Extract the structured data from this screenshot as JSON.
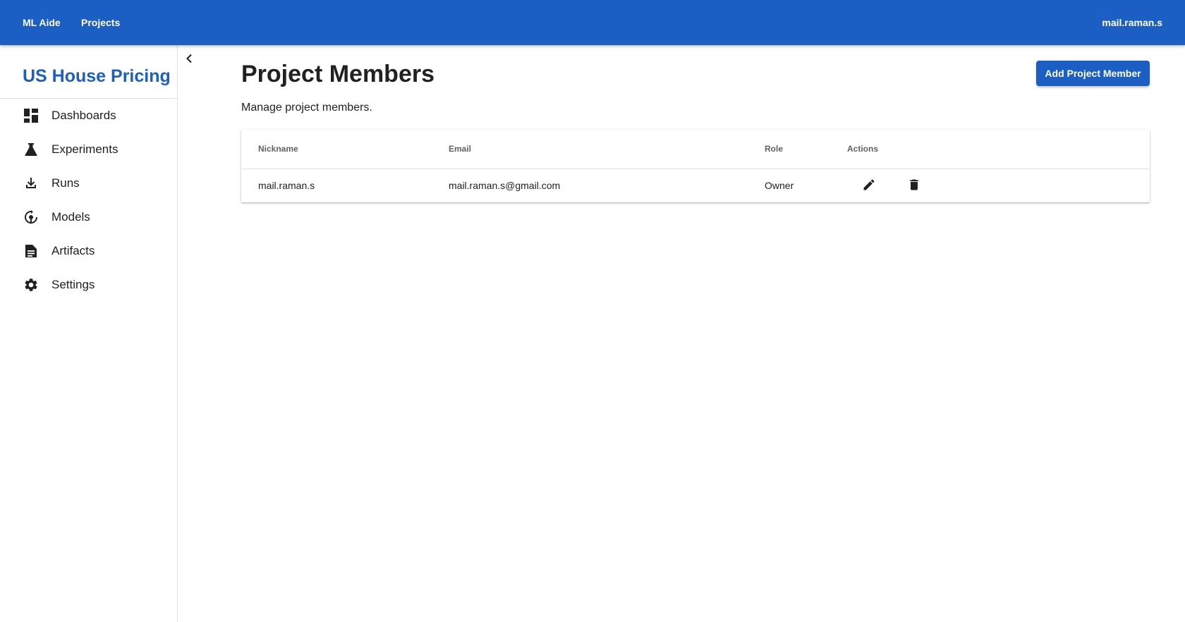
{
  "topbar": {
    "brand": "ML Aide",
    "projects": "Projects",
    "user": "mail.raman.s"
  },
  "sidebar": {
    "project_title": "US House Pricing",
    "items": [
      {
        "label": "Dashboards",
        "icon": "dashboard-icon"
      },
      {
        "label": "Experiments",
        "icon": "flask-icon"
      },
      {
        "label": "Runs",
        "icon": "run-download-icon"
      },
      {
        "label": "Models",
        "icon": "model-cycle-icon"
      },
      {
        "label": "Artifacts",
        "icon": "document-icon"
      },
      {
        "label": "Settings",
        "icon": "gear-icon"
      }
    ]
  },
  "main": {
    "title": "Project Members",
    "subtitle": "Manage project members.",
    "add_button": "Add Project Member",
    "table": {
      "headers": {
        "nickname": "Nickname",
        "email": "Email",
        "role": "Role",
        "actions": "Actions"
      },
      "rows": [
        {
          "nickname": "mail.raman.s",
          "email": "mail.raman.s@gmail.com",
          "role": "Owner"
        }
      ]
    }
  },
  "colors": {
    "primary": "#1c5fc4",
    "text": "#212121",
    "muted": "#616161",
    "divider": "#e0e0e0"
  }
}
